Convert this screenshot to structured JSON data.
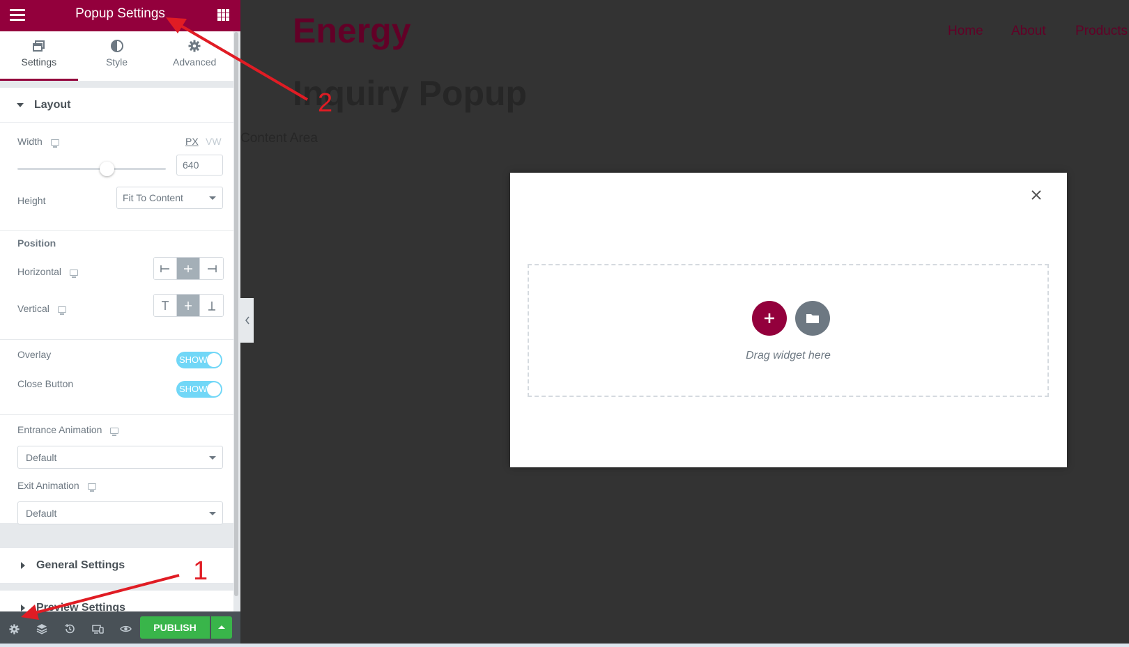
{
  "panel": {
    "title": "Popup Settings",
    "tabs": [
      {
        "label": "Settings",
        "icon": "settings-window-icon"
      },
      {
        "label": "Style",
        "icon": "half-circle-icon"
      },
      {
        "label": "Advanced",
        "icon": "gear-icon"
      }
    ],
    "layout": {
      "title": "Layout",
      "width_label": "Width",
      "unit_px": "PX",
      "unit_vw": "VW",
      "width_value": "640",
      "width_slider_fraction": 0.6,
      "height_label": "Height",
      "height_value": "Fit To Content",
      "position_title": "Position",
      "horizontal_label": "Horizontal",
      "vertical_label": "Vertical",
      "overlay_label": "Overlay",
      "overlay_toggle": "SHOW",
      "close_button_label": "Close Button",
      "close_button_toggle": "SHOW",
      "entrance_label": "Entrance Animation",
      "entrance_value": "Default",
      "exit_label": "Exit Animation",
      "exit_value": "Default"
    },
    "sections": {
      "general": "General Settings",
      "preview": "Preview Settings"
    },
    "footer": {
      "publish_label": "PUBLISH"
    }
  },
  "canvas": {
    "brand": "Energy",
    "nav": [
      "Home",
      "About",
      "Products"
    ],
    "page_title": "Inquiry Popup",
    "content_area": "Content Area",
    "drag_text": "Drag widget here"
  },
  "annotations": [
    "1",
    "2"
  ],
  "colors": {
    "brand": "#93003c",
    "publish": "#39b54a",
    "toggle": "#71d7f7",
    "annotation": "#e01c24"
  }
}
